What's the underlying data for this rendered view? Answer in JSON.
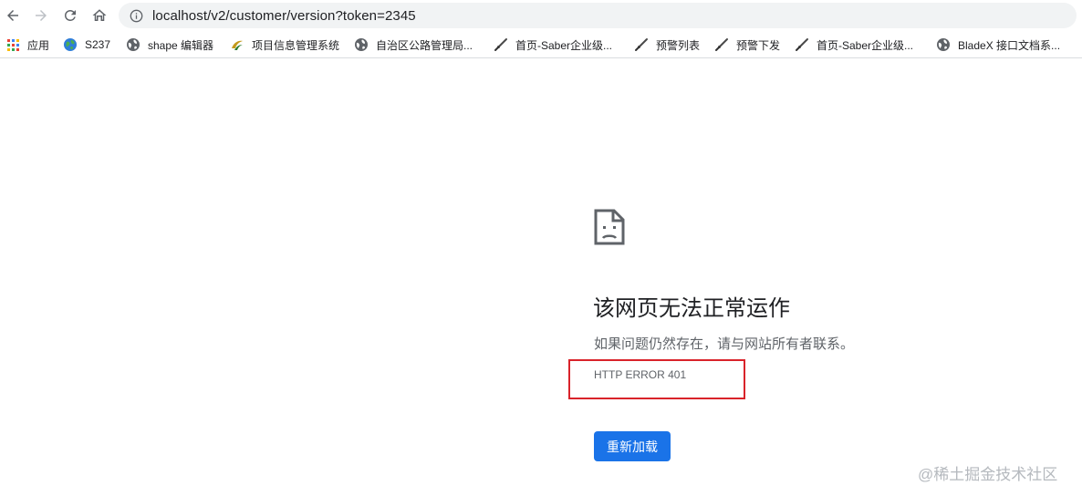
{
  "address_bar": {
    "url": "localhost/v2/customer/version?token=2345"
  },
  "bookmarks": [
    {
      "label": "应用",
      "icon": "apps-grid-icon"
    },
    {
      "label": "S237",
      "icon": "globe-earth-icon"
    },
    {
      "label": "shape 编辑器",
      "icon": "globe-icon"
    },
    {
      "label": "项目信息管理系统",
      "icon": "project-logo-icon"
    },
    {
      "label": "自治区公路管理局...",
      "icon": "globe-icon"
    },
    {
      "label": "首页-Saber企业级...",
      "icon": "sword-icon"
    },
    {
      "label": "预警列表",
      "icon": "sword-icon"
    },
    {
      "label": "预警下发",
      "icon": "sword-icon"
    },
    {
      "label": "首页-Saber企业级...",
      "icon": "sword-icon"
    },
    {
      "label": "BladeX 接口文档系...",
      "icon": "globe-icon"
    }
  ],
  "error_page": {
    "icon": "sad-page-icon",
    "title": "该网页无法正常运作",
    "description": "如果问题仍然存在，请与网站所有者联系。",
    "error_code": "HTTP ERROR 401",
    "reload_label": "重新加载"
  },
  "watermark": "@稀土掘金技术社区",
  "colors": {
    "primary_button": "#1a73e8",
    "highlight_border": "#d9232a",
    "omnibox_bg": "#f1f3f4"
  }
}
